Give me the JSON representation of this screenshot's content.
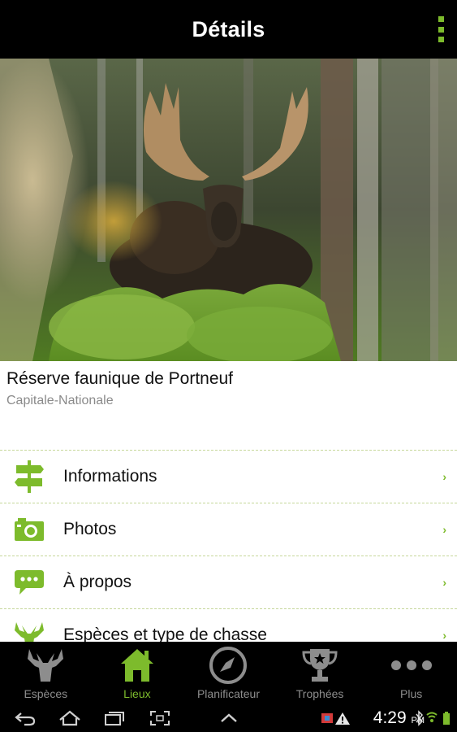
{
  "action_bar": {
    "title": "Détails",
    "overflow_icon": "overflow-menu-icon"
  },
  "hero": {
    "description_icon": "moose-photo"
  },
  "place": {
    "name": "Réserve faunique de Portneuf",
    "region": "Capitale-Nationale"
  },
  "menu": {
    "items": [
      {
        "label": "Informations",
        "icon": "signpost-icon"
      },
      {
        "label": "Photos",
        "icon": "camera-icon"
      },
      {
        "label": "À propos",
        "icon": "speech-bubble-icon"
      },
      {
        "label": "Espèces et type de chasse",
        "icon": "deer-head-icon"
      }
    ],
    "chevron": "›"
  },
  "tabs": [
    {
      "label": "Espèces",
      "icon": "deer-head-icon",
      "active": false
    },
    {
      "label": "Lieux",
      "icon": "home-icon",
      "active": true
    },
    {
      "label": "Planificateur",
      "icon": "compass-icon",
      "active": false
    },
    {
      "label": "Trophées",
      "icon": "trophy-icon",
      "active": false
    },
    {
      "label": "Plus",
      "icon": "more-dots-icon",
      "active": false
    }
  ],
  "system_bar": {
    "time": "4:29",
    "ampm": "PM"
  },
  "colors": {
    "accent": "#7dbb2c",
    "bar_background": "#000000",
    "inactive_tab": "#8d8d8d"
  }
}
